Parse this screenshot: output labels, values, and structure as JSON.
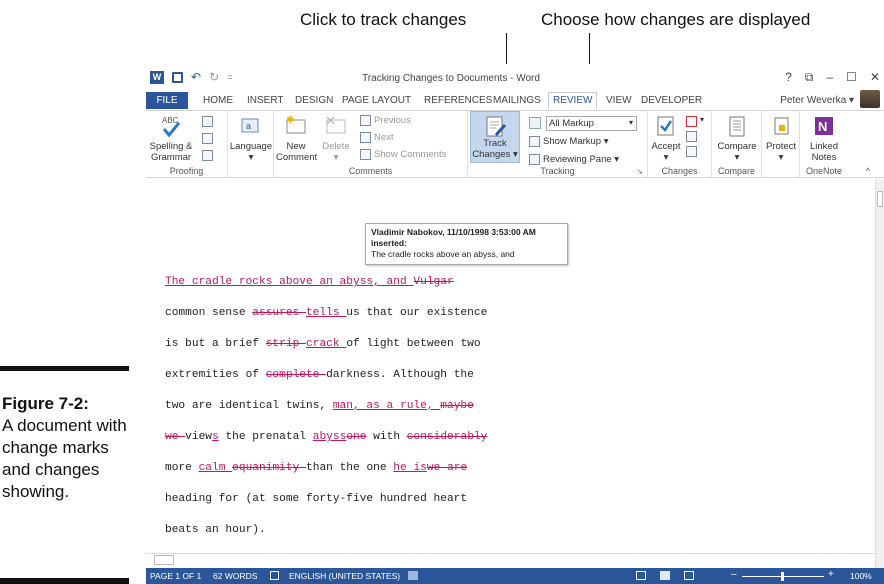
{
  "callouts": {
    "track": "Click to track changes",
    "display": "Choose how changes are displayed"
  },
  "figure": {
    "label": "Figure 7-2:",
    "caption": "A document with change marks and changes showing."
  },
  "window": {
    "title": "Tracking Changes to Documents - Word",
    "help": "?",
    "ribbon_toggle": "⧉",
    "minimize": "–",
    "maximize": "☐",
    "close": "✕",
    "user": "Peter Weverka",
    "user_arrow": "▾"
  },
  "tabs": [
    "FILE",
    "HOME",
    "INSERT",
    "DESIGN",
    "PAGE LAYOUT",
    "REFERENCES",
    "MAILINGS",
    "REVIEW",
    "VIEW",
    "DEVELOPER"
  ],
  "ribbon": {
    "proofing": {
      "spelling": "Spelling &",
      "grammar": "Grammar",
      "label": "Proofing"
    },
    "language": {
      "button": "Language",
      "arrow": "▾",
      "label": ""
    },
    "comments": {
      "new": "New",
      "comment": "Comment",
      "delete": "Delete",
      "delete_arrow": "▾",
      "previous": "Previous",
      "next": "Next",
      "show": "Show Comments",
      "label": "Comments"
    },
    "tracking": {
      "track1": "Track",
      "track2": "Changes ▾",
      "markup": "All Markup",
      "markup_arrow": "▾",
      "show_markup": "Show Markup ▾",
      "reviewing_pane": "Reviewing Pane ▾",
      "label": "Tracking",
      "launcher": "↘"
    },
    "changes": {
      "accept": "Accept",
      "accept_arrow": "▾",
      "reject_arrow": "▾",
      "label": "Changes"
    },
    "compare": {
      "button": "Compare",
      "arrow": "▾",
      "label": "Compare"
    },
    "protect": {
      "button": "Protect",
      "arrow": "▾",
      "label": ""
    },
    "onenote": {
      "linked": "Linked",
      "notes": "Notes",
      "label": "OneNote",
      "collapse": "^"
    }
  },
  "tooltip": {
    "author": "Vladimir Nabokov, 11/10/1998 3:53:00 AM",
    "action": "inserted:",
    "text": "The cradle rocks above an abyss, and"
  },
  "document": {
    "l1_ins": "The cradle rocks above an abyss, and ",
    "l1_del": "Vulgar",
    "l2_a": "common sense ",
    "l2_del": "assures ",
    "l2_ins": "tells ",
    "l2_b": "us that our existence",
    "l3_a": "is but a brief ",
    "l3_del": "strip ",
    "l3_ins": " crack ",
    "l3_b": "of light between two",
    "l4_a": "extremities of ",
    "l4_del": "complete ",
    "l4_b": "darkness. Although the",
    "l5_a": "two are identical twins, ",
    "l5_ins": "man, as a rule, ",
    "l5_del": "maybe",
    "l6_del": "we ",
    "l6_a": "view",
    "l6_ins": "s",
    "l6_b": " the prenatal ",
    "l6_ins2": "abyss",
    "l6_del2": "one",
    "l6_c": " with ",
    "l6_del3": "considerably",
    "l7_a": "more ",
    "l7_ins": "calm ",
    "l7_del": "equanimity ",
    "l7_b": "than the one ",
    "l7_ins2": "he is",
    "l7_del2": "we are",
    "l8": "heading for (at some forty-five hundred heart",
    "l9": "beats an hour)."
  },
  "status": {
    "page": "PAGE 1 OF 1",
    "words": "62 WORDS",
    "language": "ENGLISH (UNITED STATES)",
    "zoom": "100%",
    "minus": "–",
    "plus": "+"
  }
}
